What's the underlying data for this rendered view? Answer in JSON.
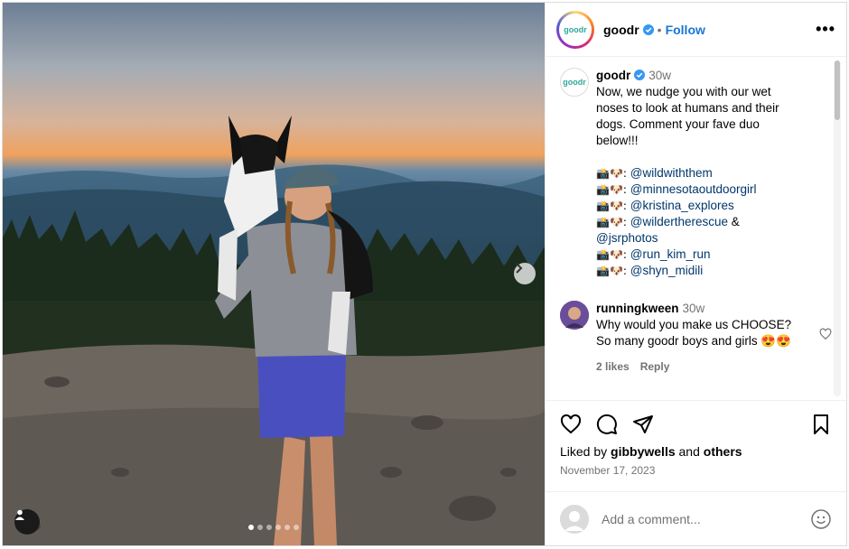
{
  "post": {
    "username": "goodr",
    "follow_label": "Follow",
    "separator": "•",
    "more_label": "•••",
    "avatar_text": "goodr"
  },
  "caption": {
    "username": "goodr",
    "time": "30w",
    "text": "Now, we nudge you with our wet noses to look at humans and their dogs. Comment your fave duo below!!!",
    "credits": [
      {
        "emoji": "📸🐶",
        "handle": "@wildwiththem"
      },
      {
        "emoji": "📸🐶",
        "handle": "@minnesotaoutdoorgirl"
      },
      {
        "emoji": "📸🐶",
        "handle": "@kristina_explores"
      },
      {
        "emoji": "📸🐶",
        "handle": "@wildertherescue",
        "extra": " &",
        "handle2": "@jsrphotos"
      },
      {
        "emoji": "📸🐶",
        "handle": "@run_kim_run"
      },
      {
        "emoji": "📸🐶",
        "handle": "@shyn_midili"
      }
    ]
  },
  "comment": {
    "username": "runningkween",
    "time": "30w",
    "text": "Why would you make us CHOOSE? So many goodr boys and girls 😍😍",
    "likes": "2 likes",
    "reply_label": "Reply"
  },
  "footer": {
    "liked_prefix": "Liked by",
    "liked_user": "gibbywells",
    "liked_and": "and",
    "liked_others": "others",
    "date": "November 17, 2023",
    "add_comment_placeholder": "Add a comment..."
  },
  "carousel": {
    "slide_count": 6,
    "active_index": 0
  },
  "colors": {
    "link": "#1877d2",
    "mention": "#00376b",
    "muted": "#737373"
  }
}
